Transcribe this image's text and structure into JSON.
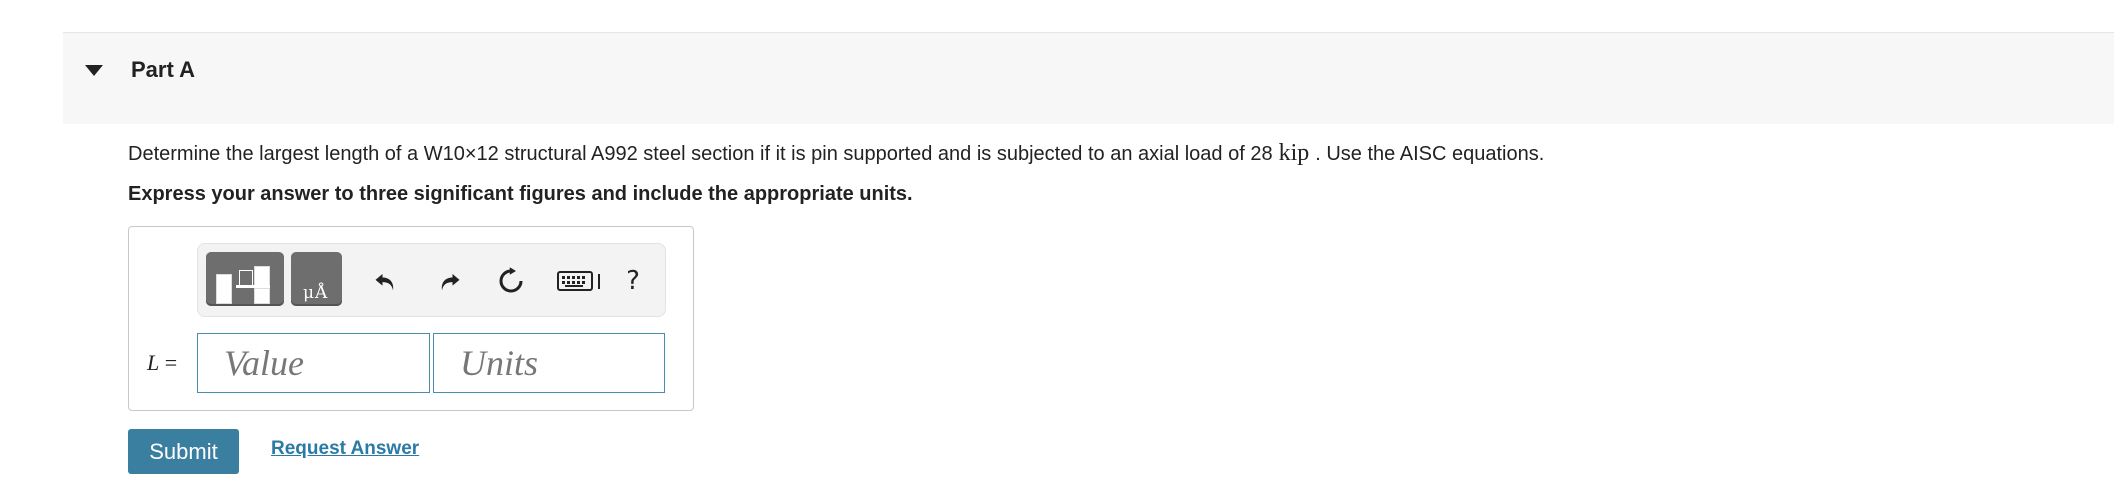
{
  "part": {
    "title": "Part A"
  },
  "question": {
    "text_before": "Determine the largest length of a W10×12 structural A992 steel section if it is pin supported and is subjected to an axial load of 28",
    "unit": "kip",
    "text_after": ". Use the AISC equations."
  },
  "instruction": "Express your answer to three significant figures and include the appropriate units.",
  "answer": {
    "variable": "L",
    "equals": "=",
    "value_placeholder": "Value",
    "units_placeholder": "Units",
    "units_button_glyph": "μÅ",
    "help_label": "?"
  },
  "toolbar_icons": [
    "templates-icon",
    "units-icon",
    "undo-icon",
    "redo-icon",
    "reset-icon",
    "keyboard-icon",
    "help-icon"
  ],
  "actions": {
    "submit_label": "Submit",
    "request_label": "Request Answer"
  },
  "colors": {
    "submit_bg": "#3a7fa0",
    "link": "#2a7aa6",
    "field_border": "#4a8bb0",
    "toolbar_button": "#6e6e6e"
  }
}
